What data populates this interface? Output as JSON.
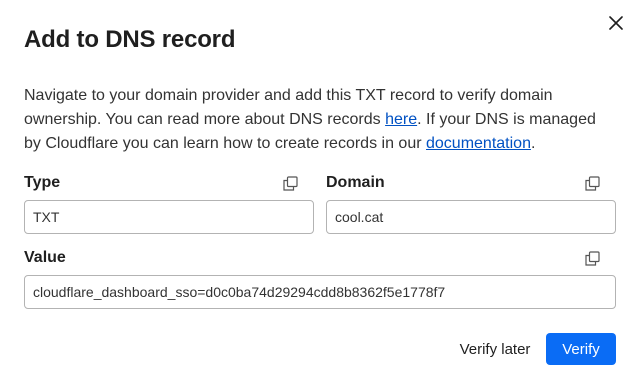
{
  "modal": {
    "title": "Add to DNS record",
    "description": {
      "part1": "Navigate to your domain provider and add this TXT record to verify domain ownership. You can read more about DNS records ",
      "link1": "here",
      "part2": ". If your DNS is managed by Cloudflare you can learn how to create records in our ",
      "link2": "documentation",
      "part3": "."
    }
  },
  "fields": {
    "type": {
      "label": "Type",
      "value": "TXT"
    },
    "domain": {
      "label": "Domain",
      "value": "cool.cat"
    },
    "value": {
      "label": "Value",
      "value": "cloudflare_dashboard_sso=d0c0ba74d29294cdd8b8362f5e1778f7"
    }
  },
  "buttons": {
    "verify_later": "Verify later",
    "verify": "Verify"
  },
  "icons": {
    "close": "close-icon",
    "copy": "copy-icon"
  },
  "colors": {
    "primary": "#0a6cf5",
    "link": "#0051c3"
  }
}
